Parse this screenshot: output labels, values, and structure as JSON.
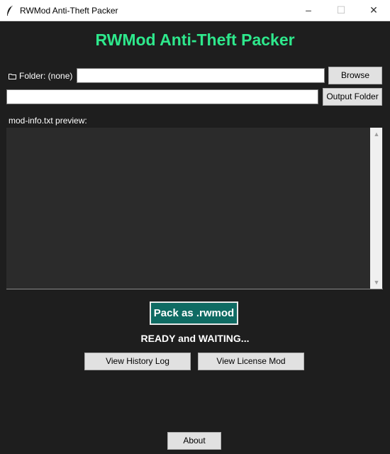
{
  "window": {
    "title": "RWMod Anti-Theft Packer",
    "controls": {
      "minimize": "–",
      "maximize": "☐",
      "close": "✕"
    }
  },
  "app": {
    "heading": "RWMod Anti-Theft Packer",
    "heading_color": "#2ee88c",
    "background": "#1e1e1e"
  },
  "folder": {
    "label": "Folder: (none)",
    "value": "",
    "browse_label": "Browse"
  },
  "output": {
    "value": "",
    "button_label": "Output Folder"
  },
  "preview": {
    "label": "mod-info.txt preview:",
    "content": ""
  },
  "actions": {
    "pack_label": "Pack as .rwmod",
    "pack_color": "#0f6b63",
    "status": "READY and WAITING...",
    "history_label": "View History Log",
    "license_label": "View License Mod",
    "about_label": "About"
  }
}
